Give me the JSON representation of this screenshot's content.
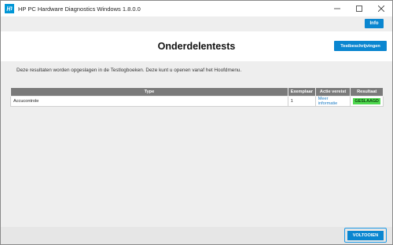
{
  "window": {
    "title": "HP PC Hardware Diagnostics Windows 1.8.0.0",
    "icon": "hp-logo-icon",
    "controls": [
      "minimize-icon",
      "maximize-icon",
      "close-icon"
    ]
  },
  "topbar": {
    "info_label": "Info"
  },
  "header": {
    "title": "Onderdelentests",
    "descriptions_label": "Testbeschrijvingen"
  },
  "main": {
    "notice": "Deze resultaten worden opgeslagen in de Testlogboeken. Deze kunt u openen vanaf het Hoofdmenu.",
    "table": {
      "columns": [
        "Type",
        "Exemplaar",
        "Actie vereist",
        "Resultaat"
      ],
      "rows": [
        {
          "type": "Accucontrole",
          "instance": "1",
          "action": "Meer informatie",
          "result": "GESLAAGD"
        }
      ]
    }
  },
  "footer": {
    "done_label": "VOLTOOIEN"
  },
  "colors": {
    "accent": "#0a86d0",
    "pass": "#4fd84f",
    "header_bg": "#7a7a7a",
    "panel_bg": "#eeeeee"
  }
}
